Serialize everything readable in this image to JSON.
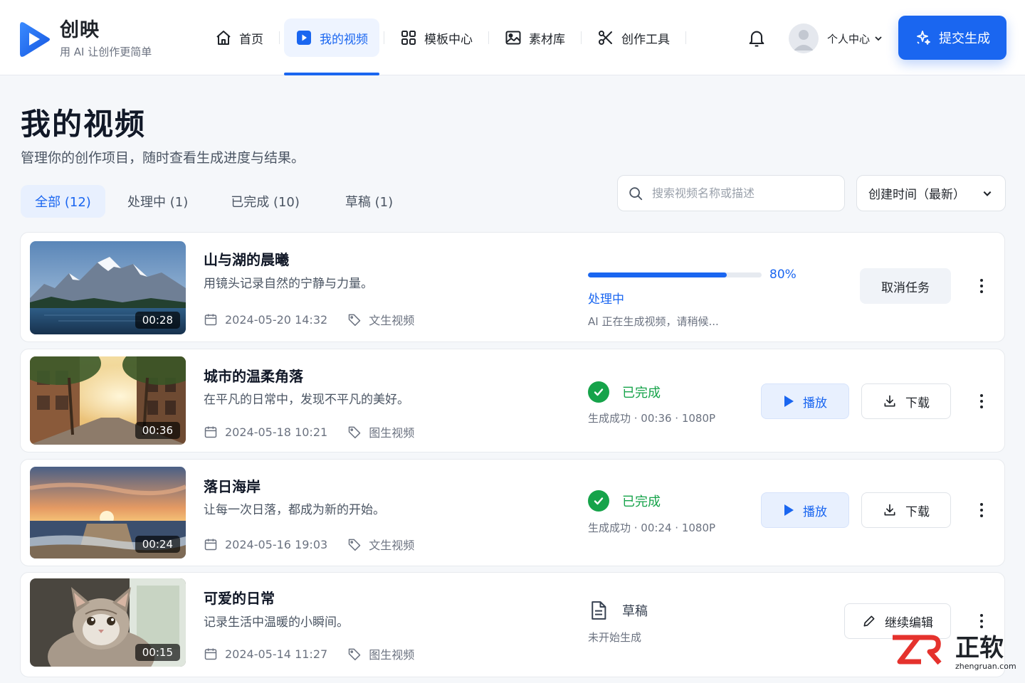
{
  "app": {
    "name": "创映",
    "tagline": "用 AI 让创作更简单"
  },
  "nav": [
    {
      "label": "首页",
      "icon": "home-icon",
      "active": false
    },
    {
      "label": "我的视频",
      "icon": "video-icon",
      "active": true
    },
    {
      "label": "模板中心",
      "icon": "grid-icon",
      "active": false
    },
    {
      "label": "素材库",
      "icon": "image-icon",
      "active": false
    },
    {
      "label": "创作工具",
      "icon": "tools-icon",
      "active": false
    }
  ],
  "header": {
    "user_label": "个人中心",
    "submit_label": "提交生成"
  },
  "page": {
    "title": "我的视频",
    "subtitle": "管理你的创作项目，随时查看生成进度与结果。"
  },
  "tabs": [
    {
      "label": "全部 (12)",
      "active": true
    },
    {
      "label": "处理中 (1)",
      "active": false
    },
    {
      "label": "已完成 (10)",
      "active": false
    },
    {
      "label": "草稿 (1)",
      "active": false
    }
  ],
  "search": {
    "placeholder": "搜索视频名称或描述",
    "value": ""
  },
  "sort": {
    "selected": "创建时间（最新）"
  },
  "videos": [
    {
      "title": "山与湖的晨曦",
      "desc": "用镜头记录自然的宁静与力量。",
      "duration": "00:28",
      "date": "2024-05-20 14:32",
      "type": "文生视频",
      "status": "processing",
      "status_label": "处理中",
      "progress": 0.8,
      "progress_label": "80%",
      "note": "AI 正在生成视频，请稍候...",
      "action_label": "取消任务"
    },
    {
      "title": "城市的温柔角落",
      "desc": "在平凡的日常中，发现不平凡的美好。",
      "duration": "00:36",
      "date": "2024-05-18 10:21",
      "type": "图生视频",
      "status": "done",
      "status_label": "已完成",
      "note": "生成成功 · 00:36 · 1080P",
      "play_label": "播放",
      "download_label": "下载"
    },
    {
      "title": "落日海岸",
      "desc": "让每一次日落，都成为新的开始。",
      "duration": "00:24",
      "date": "2024-05-16 19:03",
      "type": "文生视频",
      "status": "done",
      "status_label": "已完成",
      "note": "生成成功 · 00:24 · 1080P",
      "play_label": "播放",
      "download_label": "下载"
    },
    {
      "title": "可爱的日常",
      "desc": "记录生活中温暖的小瞬间。",
      "duration": "00:15",
      "date": "2024-05-14 11:27",
      "type": "图生视频",
      "status": "draft",
      "status_label": "草稿",
      "note": "未开始生成",
      "action_label": "继续编辑"
    }
  ],
  "watermark": {
    "brand": "正软",
    "url": "zhengruan.com"
  },
  "colors": {
    "accent": "#1a66f0",
    "success": "#16a34a",
    "background": "#f5f7fa"
  }
}
